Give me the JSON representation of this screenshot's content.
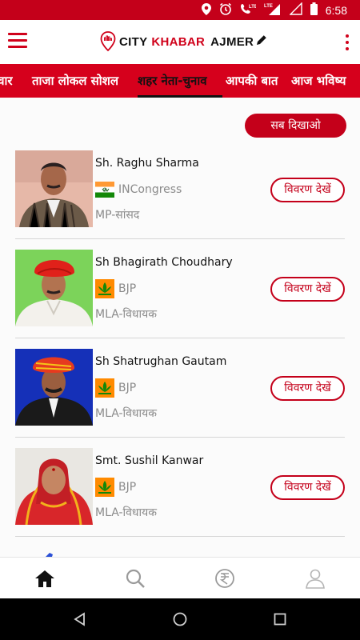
{
  "status_bar": {
    "time": "6:58",
    "icons": [
      "location-icon",
      "alarm-icon",
      "lte-call-icon",
      "lte-signal-icon",
      "wifi-signal-icon",
      "battery-icon"
    ],
    "lte_label": "LTE"
  },
  "app_bar": {
    "brand_word1": "CITY",
    "brand_word2": "KHABAR",
    "brand_word3": "AJMER",
    "accent_color": "#d0021b"
  },
  "tabs": [
    {
      "label": "चार",
      "active": false
    },
    {
      "label": "ताजा लोकल सोशल",
      "active": false
    },
    {
      "label": "शहर नेता-चुनाव",
      "active": true
    },
    {
      "label": "आपकी बात",
      "active": false
    },
    {
      "label": "आज भविष्य",
      "active": false
    }
  ],
  "show_all_label": "सब दिखाओ",
  "leaders": [
    {
      "name": "Sh. Raghu Sharma",
      "party": "INCongress",
      "party_icon": "congress-flag-icon",
      "role": "MP-सांसद",
      "details_label": "विवरण देखें"
    },
    {
      "name": "Sh Bhagirath Choudhary",
      "party": "BJP",
      "party_icon": "bjp-lotus-icon",
      "role": "MLA-विधायक",
      "details_label": "विवरण देखें"
    },
    {
      "name": "Sh Shatrughan Gautam",
      "party": "BJP",
      "party_icon": "bjp-lotus-icon",
      "role": "MLA-विधायक",
      "details_label": "विवरण देखें"
    },
    {
      "name": "Smt. Sushil Kanwar",
      "party": "BJP",
      "party_icon": "bjp-lotus-icon",
      "role": "MLA-विधायक",
      "details_label": "विवरण देखें"
    }
  ],
  "bottom_nav": [
    "home-icon",
    "search-icon",
    "rupee-coin-icon",
    "profile-icon"
  ],
  "system_nav": [
    "back-icon",
    "home-circle-icon",
    "recents-icon"
  ]
}
